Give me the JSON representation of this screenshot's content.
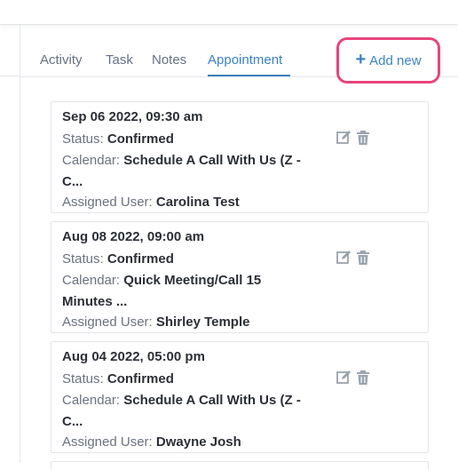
{
  "tabs": [
    {
      "label": "Activity"
    },
    {
      "label": "Task"
    },
    {
      "label": "Notes"
    },
    {
      "label": "Appointment"
    }
  ],
  "active_tab": "Appointment",
  "add_new_label": "Add new",
  "appointments": [
    {
      "date": "Sep 06 2022, 09:30 am",
      "status_label": "Status:",
      "status": "Confirmed",
      "calendar_label": "Calendar:",
      "calendar_line1": "Schedule A Call With Us (Z -",
      "calendar_line2": "C...",
      "user_label": "Assigned User:",
      "user": "Carolina Test"
    },
    {
      "date": "Aug 08 2022, 09:00 am",
      "status_label": "Status:",
      "status": "Confirmed",
      "calendar_label": "Calendar:",
      "calendar_line1": "Quick Meeting/Call 15",
      "calendar_line2": "Minutes ...",
      "user_label": "Assigned User:",
      "user": "Shirley Temple"
    },
    {
      "date": "Aug 04 2022, 05:00 pm",
      "status_label": "Status:",
      "status": "Confirmed",
      "calendar_label": "Calendar:",
      "calendar_line1": "Schedule A Call With Us (Z -",
      "calendar_line2": "C...",
      "user_label": "Assigned User:",
      "user": "Dwayne Josh"
    }
  ],
  "colors": {
    "accent": "#3b82c4",
    "highlight": "#e8457a",
    "icon_gray": "#9aa3ad"
  }
}
